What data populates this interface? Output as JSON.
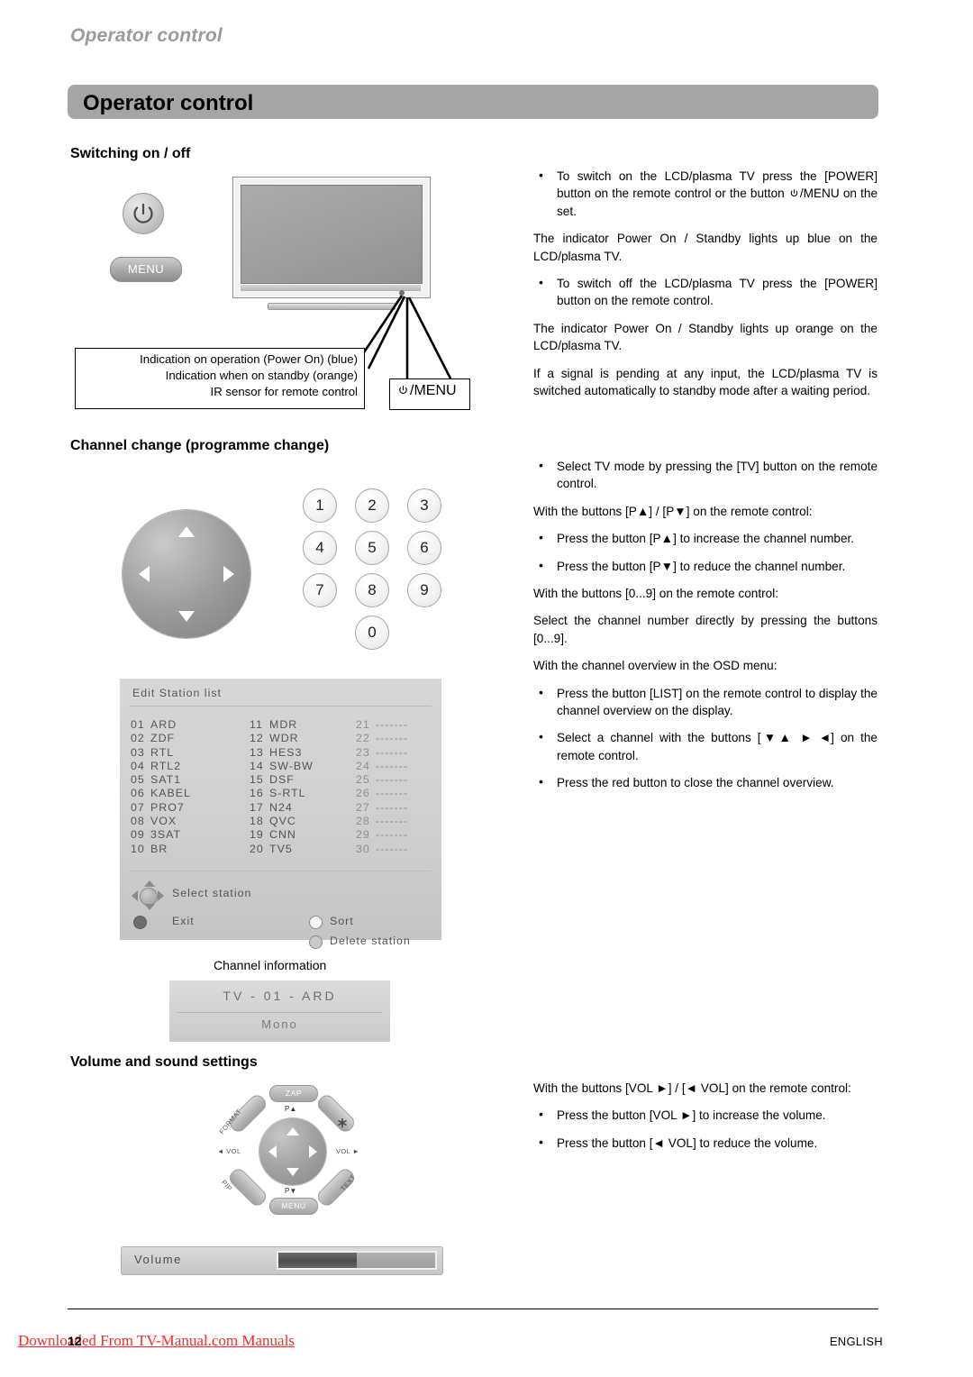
{
  "header": {
    "running_head": "Operator control",
    "title": "Operator control"
  },
  "sections": {
    "switching": {
      "heading": "Switching on / off"
    },
    "channel": {
      "heading": "Channel change (programme change)"
    },
    "volume": {
      "heading": "Volume and sound settings"
    }
  },
  "switching_text": {
    "b1_pre": "To switch on the LCD/plasma TV press the [POWER] button on the remote control or the button ",
    "b1_post": "/MENU on the set.",
    "p1": "The indicator Power On / Standby lights up blue on the LCD/plasma TV.",
    "b2": "To switch off the LCD/plasma TV press the [POWER] button on the remote control.",
    "p2": "The indicator Power On / Standby lights up orange on the LCD/plasma TV.",
    "p3": "If a signal is pending at any input, the LCD/plasma TV is switched automatically to standby mode after a waiting period."
  },
  "channel_text": {
    "b1": "Select TV mode by pressing the [TV] button on the remote control.",
    "p1": "With the buttons [P▲] / [P▼] on the remote control:",
    "b2": "Press the button [P▲] to increase the channel number.",
    "b3": "Press the button [P▼] to reduce the channel number.",
    "p2": "With the buttons [0...9] on the remote control:",
    "p3": "Select the channel number directly by pressing the buttons [0...9].",
    "p4": "With the channel overview in the OSD menu:",
    "b4": "Press the button [LIST] on the remote control to display the channel overview on the display.",
    "b5": "Select a channel with the buttons [▼▲  ► ◄]  on the remote control.",
    "b6": "Press the red button to close the channel overview."
  },
  "volume_text": {
    "p1": "With the buttons [VOL ►] / [◄  VOL] on the remote control:",
    "b1": "Press the button [VOL ►] to increase the volume.",
    "b2": "Press the button [◄  VOL] to reduce the volume."
  },
  "tv_diagram": {
    "power_button": "power-symbol",
    "menu_button": "MENU",
    "callout_line1": "Indication on operation (Power On) (blue)",
    "callout_line2": "Indication when on standby (orange)",
    "callout_line3": "IR sensor for remote control",
    "menu_label": "/MENU"
  },
  "numpad": {
    "keys": [
      "1",
      "2",
      "3",
      "4",
      "5",
      "6",
      "7",
      "8",
      "9",
      "0"
    ]
  },
  "osd_station_list": {
    "title": "Edit Station list",
    "column1": [
      {
        "num": "01",
        "name": "ARD"
      },
      {
        "num": "02",
        "name": "ZDF"
      },
      {
        "num": "03",
        "name": "RTL"
      },
      {
        "num": "04",
        "name": "RTL2"
      },
      {
        "num": "05",
        "name": "SAT1"
      },
      {
        "num": "06",
        "name": "KABEL"
      },
      {
        "num": "07",
        "name": "PRO7"
      },
      {
        "num": "08",
        "name": "VOX"
      },
      {
        "num": "09",
        "name": "3SAT"
      },
      {
        "num": "10",
        "name": "BR"
      }
    ],
    "column2": [
      {
        "num": "11",
        "name": "MDR"
      },
      {
        "num": "12",
        "name": "WDR"
      },
      {
        "num": "13",
        "name": "HES3"
      },
      {
        "num": "14",
        "name": "SW-BW"
      },
      {
        "num": "15",
        "name": "DSF"
      },
      {
        "num": "16",
        "name": "S-RTL"
      },
      {
        "num": "17",
        "name": "N24"
      },
      {
        "num": "18",
        "name": "QVC"
      },
      {
        "num": "19",
        "name": "CNN"
      },
      {
        "num": "20",
        "name": "TV5"
      }
    ],
    "column3": [
      {
        "num": "21",
        "name": "-------"
      },
      {
        "num": "22",
        "name": "-------"
      },
      {
        "num": "23",
        "name": "-------"
      },
      {
        "num": "24",
        "name": "-------"
      },
      {
        "num": "25",
        "name": "-------"
      },
      {
        "num": "26",
        "name": "-------"
      },
      {
        "num": "27",
        "name": "-------"
      },
      {
        "num": "28",
        "name": "-------"
      },
      {
        "num": "29",
        "name": "-------"
      },
      {
        "num": "30",
        "name": "-------"
      }
    ],
    "footer": {
      "select_station": "Select station",
      "exit": "Exit",
      "sort": "Sort",
      "delete_station": "Delete station"
    }
  },
  "channel_information": {
    "caption": "Channel information",
    "line1": "TV - 01 - ARD",
    "line2": "Mono"
  },
  "volume_remote": {
    "top": "ZAP",
    "bottom": "MENU",
    "up_label": "P▲",
    "down_label": "P▼",
    "left_label": "◄ VOL",
    "right_label": "VOL ►",
    "upper_left": "FORMAT",
    "lower_left": "PIP",
    "upper_right": "mute-icon",
    "lower_right": "TEXT"
  },
  "volume_osd": {
    "label": "Volume",
    "value": "15",
    "fill_percent": 50
  },
  "footer": {
    "download_note": "Downloaded From TV-Manual.com Manuals",
    "page_number": "12",
    "language": "ENGLISH"
  },
  "colors": {
    "title_bar": "#a5a5a5",
    "running_head": "#9b9b9b",
    "osd_panel": "#d2d2d2",
    "download_red": "#ff2a2a"
  }
}
